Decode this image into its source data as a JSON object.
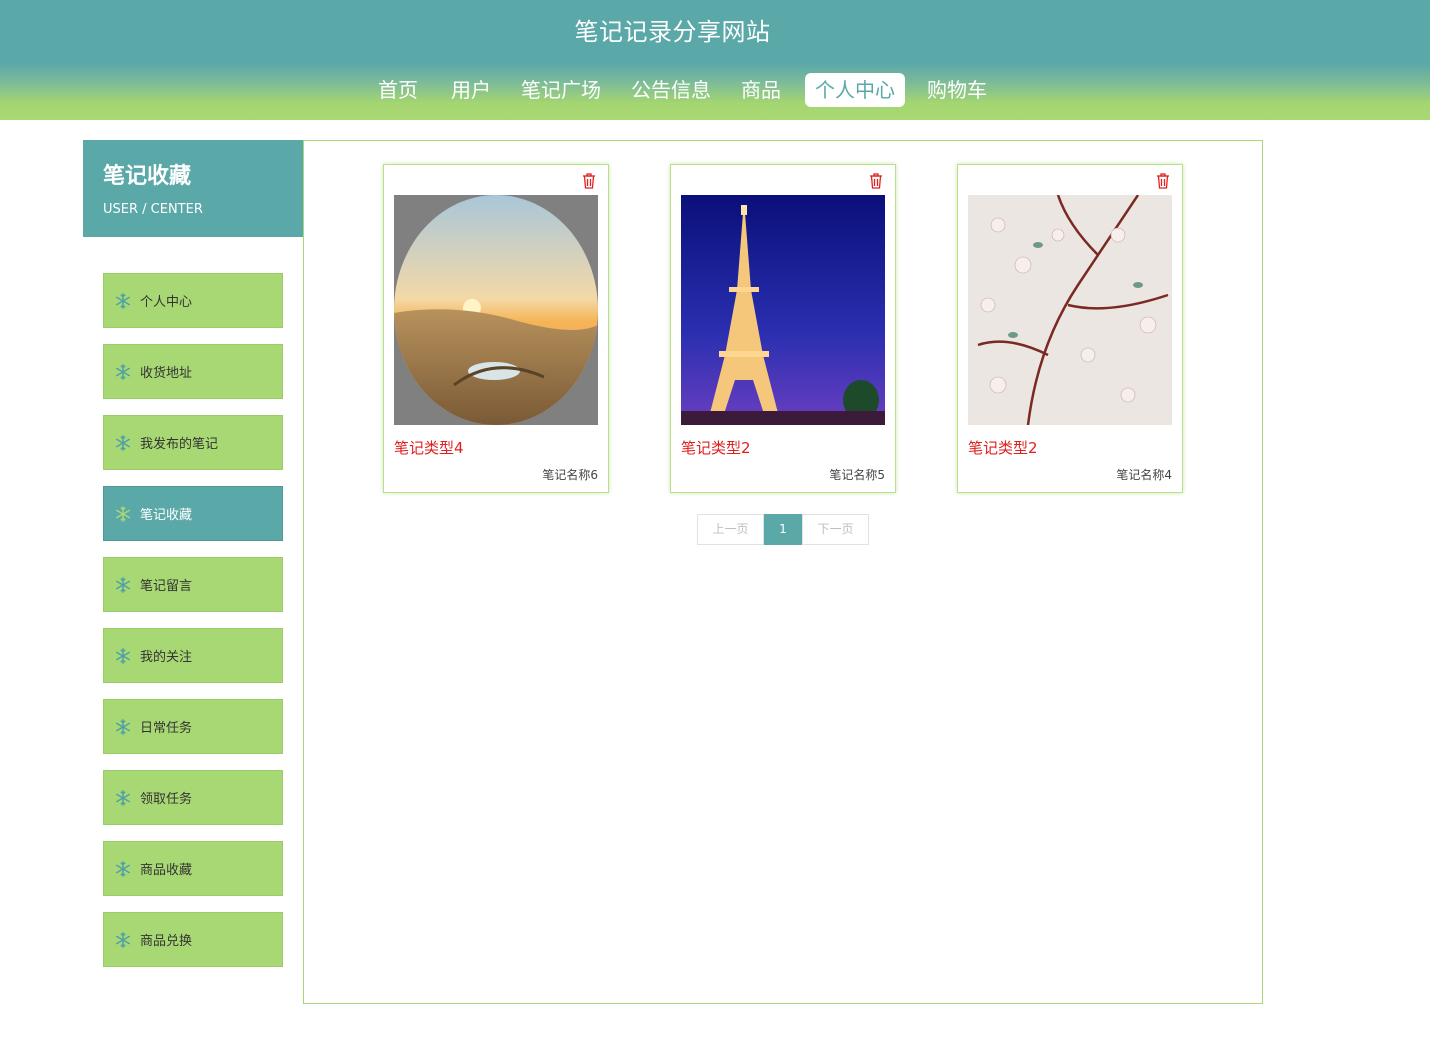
{
  "header": {
    "site_title": "笔记记录分享网站",
    "nav": [
      {
        "label": "首页"
      },
      {
        "label": "用户"
      },
      {
        "label": "笔记广场"
      },
      {
        "label": "公告信息"
      },
      {
        "label": "商品"
      },
      {
        "label": "个人中心",
        "active": true
      },
      {
        "label": "购物车"
      }
    ]
  },
  "sidebar": {
    "title": "笔记收藏",
    "subtitle": "USER / CENTER",
    "items": [
      {
        "label": "个人中心",
        "icon": "snowflake-icon"
      },
      {
        "label": "收货地址",
        "icon": "snowflake-icon"
      },
      {
        "label": "我发布的笔记",
        "icon": "snowflake-icon"
      },
      {
        "label": "笔记收藏",
        "icon": "snowflake-icon",
        "active": true
      },
      {
        "label": "笔记留言",
        "icon": "snowflake-icon"
      },
      {
        "label": "我的关注",
        "icon": "snowflake-icon"
      },
      {
        "label": "日常任务",
        "icon": "snowflake-icon"
      },
      {
        "label": "领取任务",
        "icon": "snowflake-icon"
      },
      {
        "label": "商品收藏",
        "icon": "snowflake-icon"
      },
      {
        "label": "商品兑换",
        "icon": "snowflake-icon"
      }
    ]
  },
  "favorites": [
    {
      "category": "笔记类型4",
      "name": "笔记名称6",
      "image": "desert-oasis-photo"
    },
    {
      "category": "笔记类型2",
      "name": "笔记名称5",
      "image": "eiffel-tower-photo"
    },
    {
      "category": "笔记类型2",
      "name": "笔记名称4",
      "image": "cherry-blossom-photo"
    }
  ],
  "pagination": {
    "prev": "上一页",
    "current": "1",
    "next": "下一页"
  },
  "colors": {
    "primary": "#5ba8a8",
    "accent": "#a8d874",
    "category_text": "#e02020"
  }
}
